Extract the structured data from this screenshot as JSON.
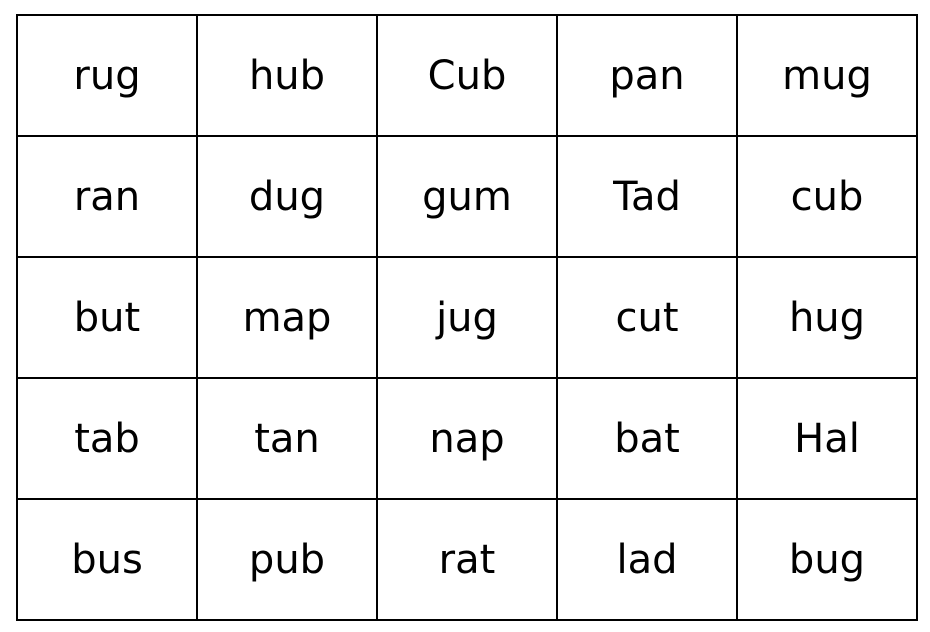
{
  "grid": {
    "rows": [
      [
        "rug",
        "hub",
        "Cub",
        "pan",
        "mug"
      ],
      [
        "ran",
        "dug",
        "gum",
        "Tad",
        "cub"
      ],
      [
        "but",
        "map",
        "jug",
        "cut",
        "hug"
      ],
      [
        "tab",
        "tan",
        "nap",
        "bat",
        "Hal"
      ],
      [
        "bus",
        "pub",
        "rat",
        "lad",
        "bug"
      ]
    ]
  }
}
